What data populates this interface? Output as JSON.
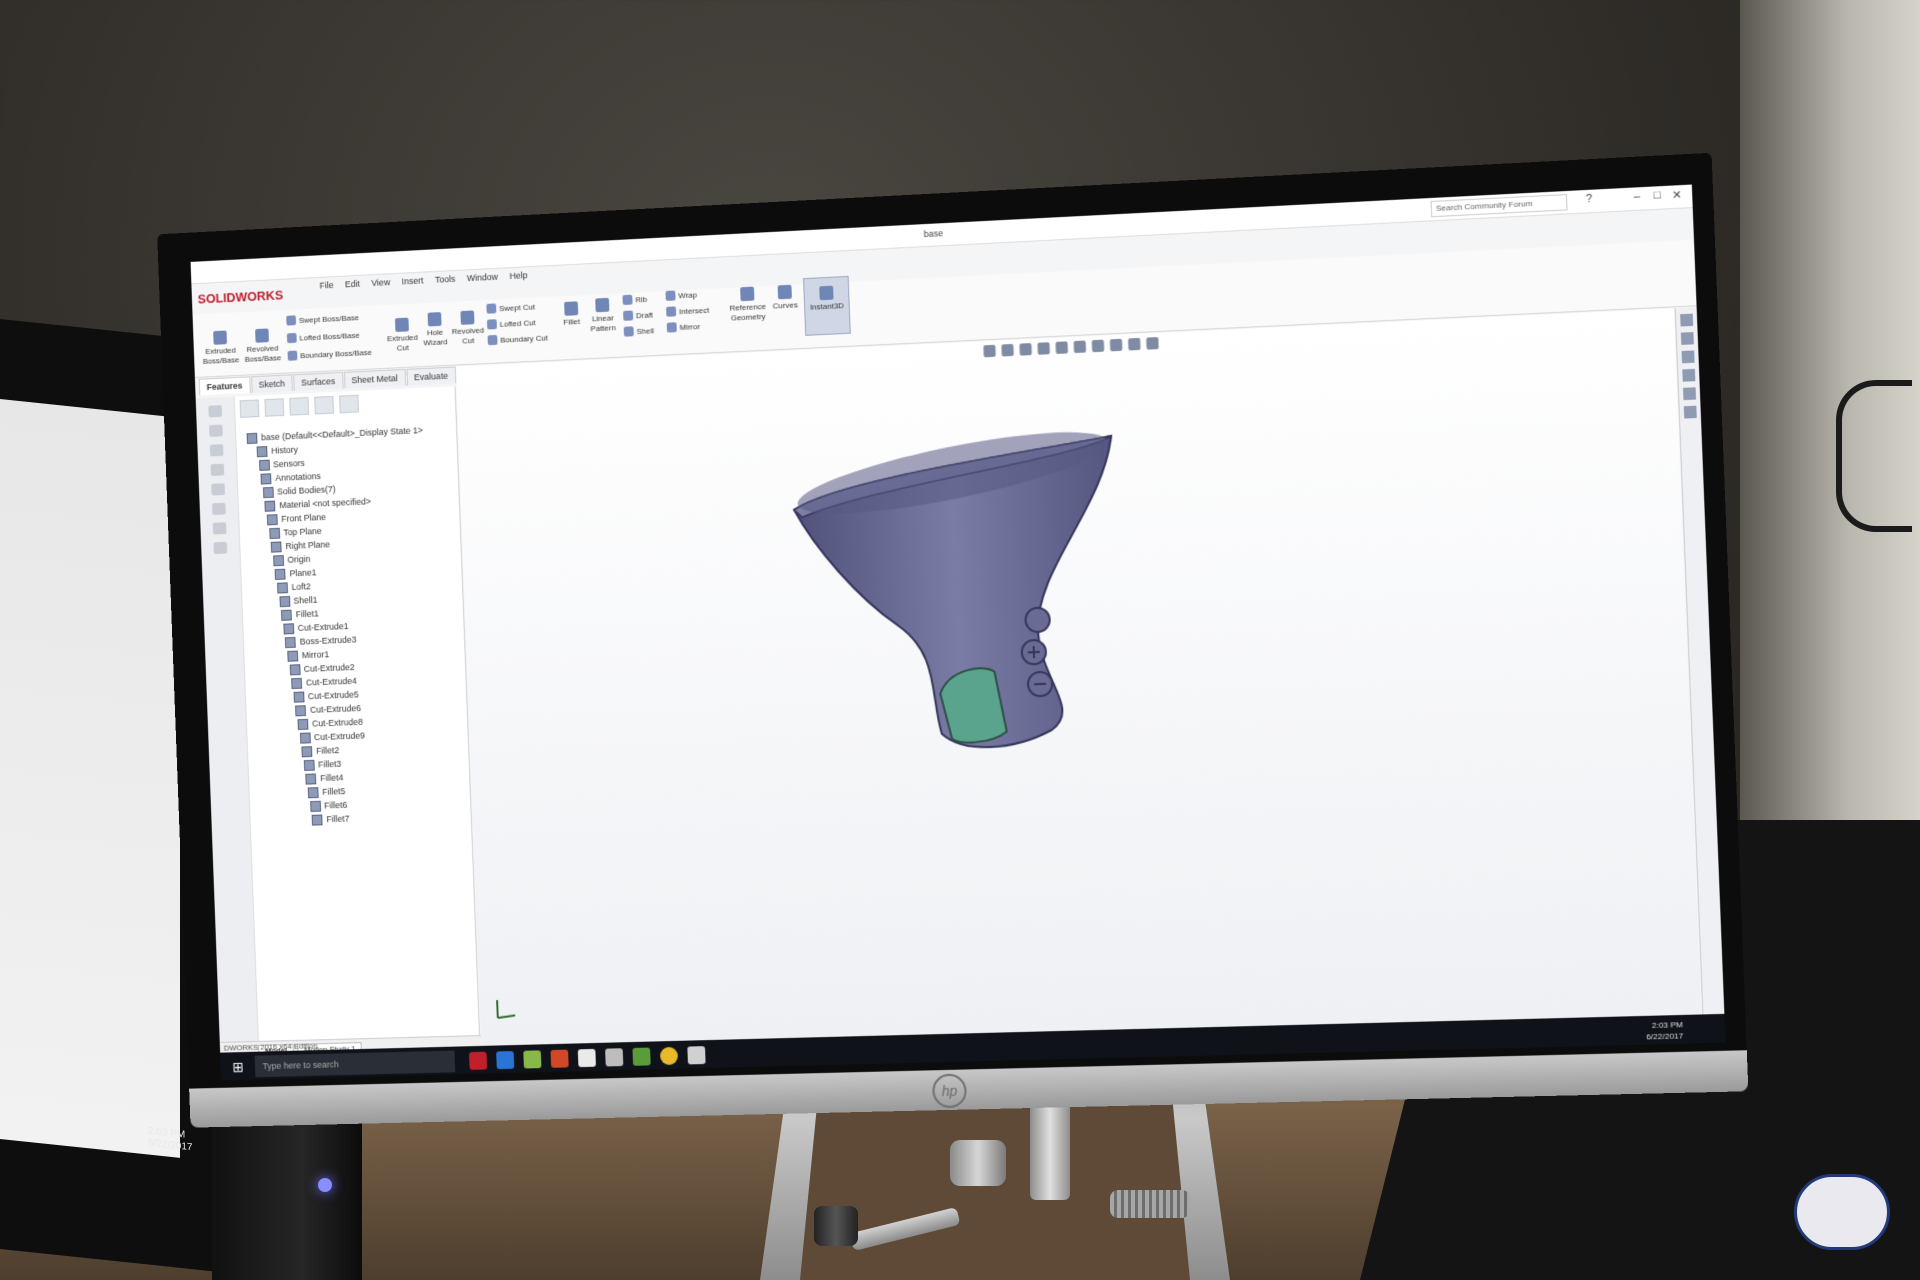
{
  "app": {
    "name": "SOLIDWORKS",
    "document_title": "base",
    "search_placeholder": "Search Community Forum"
  },
  "menu": [
    "File",
    "Edit",
    "View",
    "Insert",
    "Tools",
    "Window",
    "Help"
  ],
  "ribbon": {
    "extruded_boss": "Extruded Boss/Base",
    "revolved_boss": "Revolved Boss/Base",
    "swept_boss": "Swept Boss/Base",
    "lofted_boss": "Lofted Boss/Base",
    "boundary_boss": "Boundary Boss/Base",
    "extruded_cut": "Extruded Cut",
    "hole_wizard": "Hole Wizard",
    "revolved_cut": "Revolved Cut",
    "swept_cut": "Swept Cut",
    "lofted_cut": "Lofted Cut",
    "boundary_cut": "Boundary Cut",
    "fillet": "Fillet",
    "linear_pattern": "Linear Pattern",
    "rib": "Rib",
    "draft": "Draft",
    "shell": "Shell",
    "wrap": "Wrap",
    "intersect": "Intersect",
    "mirror": "Mirror",
    "reference_geometry": "Reference Geometry",
    "curves": "Curves",
    "instant3d": "Instant3D"
  },
  "tabs": [
    "Features",
    "Sketch",
    "Surfaces",
    "Sheet Metal",
    "Evaluate"
  ],
  "tree": {
    "root": "base (Default<<Default>_Display State 1>",
    "items": [
      "History",
      "Sensors",
      "Annotations",
      "Solid Bodies(7)",
      "Material <not specified>",
      "Front Plane",
      "Top Plane",
      "Right Plane",
      "Origin",
      "Plane1",
      "Loft2",
      "Shell1",
      "Fillet1",
      "Cut-Extrude1",
      "Boss-Extrude3",
      "Mirror1",
      "Cut-Extrude2",
      "Cut-Extrude4",
      "Cut-Extrude5",
      "Cut-Extrude6",
      "Cut-Extrude8",
      "Cut-Extrude9",
      "Fillet2",
      "Fillet3",
      "Fillet4",
      "Fillet5",
      "Fillet6",
      "Fillet7"
    ]
  },
  "bottom_tabs": [
    "Model",
    "Motion Study 1"
  ],
  "status_text": "DWORKS 2016 x64 Edition",
  "taskbar": {
    "search_placeholder": "Type here to search",
    "time": "2:03 PM",
    "date": "6/22/2017"
  },
  "left_monitor_clock": {
    "time": "2:03 PM",
    "date": "6/22/2017"
  },
  "monitor_brand": "hp",
  "colors": {
    "model_body": "#6e6f9a",
    "model_window": "#5aa48e",
    "solidworks_red": "#c21f2c"
  }
}
